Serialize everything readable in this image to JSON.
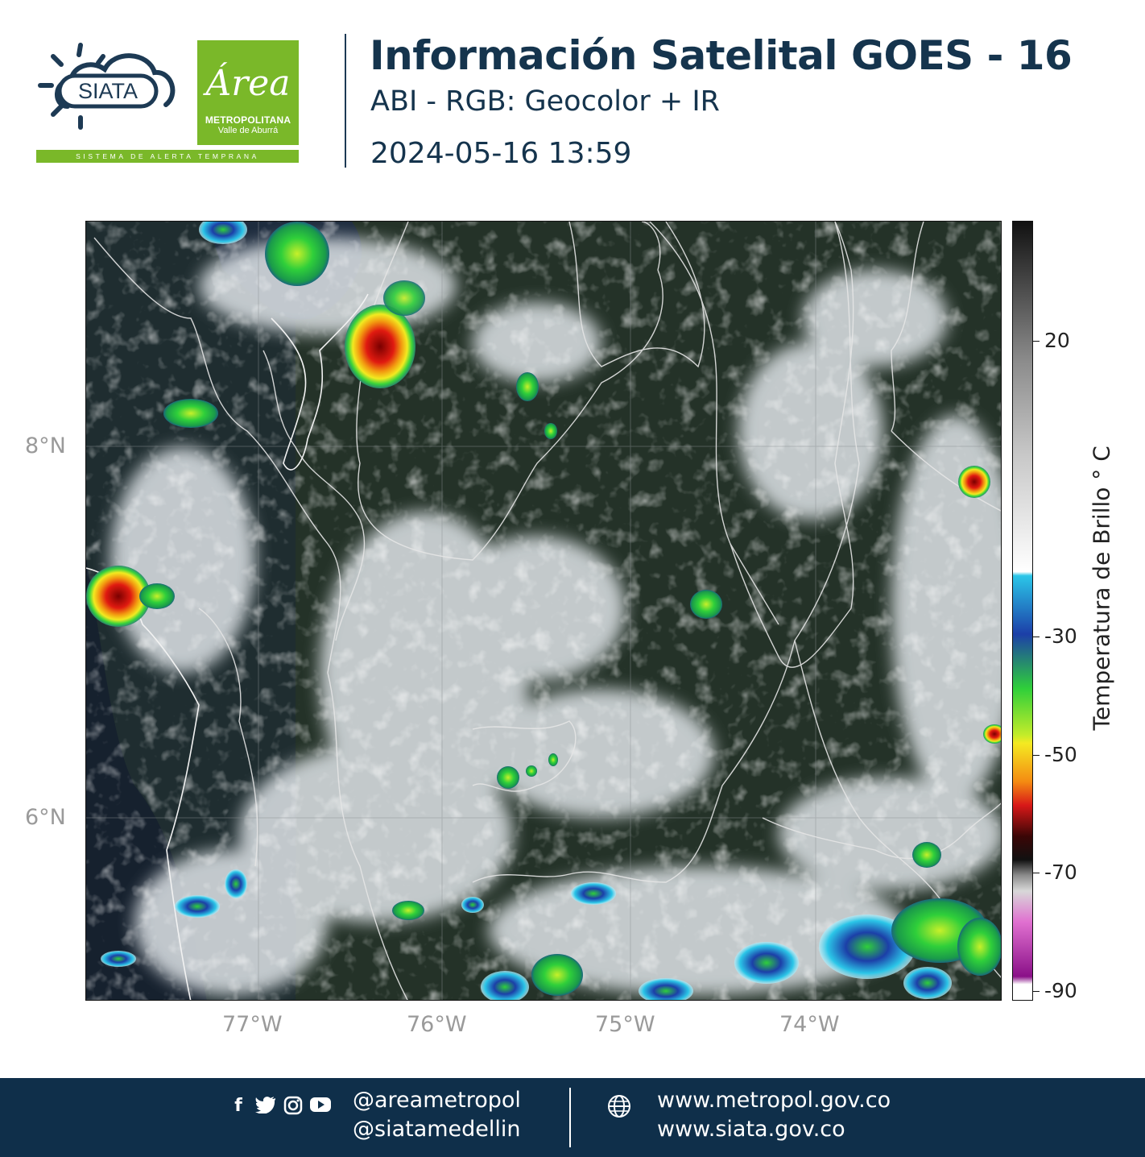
{
  "header": {
    "siata_logo_text": "SIATA",
    "area_logo_word": "Área",
    "area_logo_line1": "METROPOLITANA",
    "area_logo_line2": "Valle de Aburrá",
    "tagline": "SISTEMA DE ALERTA TEMPRANA",
    "title": "Información Satelital GOES - 16",
    "subtitle": "ABI - RGB: Geocolor + IR",
    "timestamp": "2024-05-16 13:59"
  },
  "map": {
    "lat_labels": [
      "8°N",
      "6°N"
    ],
    "lon_labels": [
      "77°W",
      "76°W",
      "75°W",
      "74°W"
    ],
    "colorbar": {
      "label": "Temperatura de Brillo ° C",
      "ticks": [
        "20",
        "-30",
        "-50",
        "-70",
        "-90"
      ],
      "colors": {
        "warm_black": "#111111",
        "gray": "#8c8c8c",
        "white": "#ffffff",
        "cyan": "#2bc6e8",
        "blue": "#1c3fa8",
        "green": "#2fcf3a",
        "yellow": "#f4ea22",
        "orange": "#f48a12",
        "red": "#d81818",
        "dark_red": "#3a0606",
        "pink": "#e070d0",
        "purple": "#8a1088"
      }
    },
    "icons": [
      "map-coastline",
      "map-admin-borders",
      "convective-cells"
    ]
  },
  "footer": {
    "social_icons": [
      "facebook-icon",
      "twitter-icon",
      "instagram-icon",
      "youtube-icon"
    ],
    "handles": [
      "@areametropol",
      "@siatamedellin"
    ],
    "sites": [
      "www.metropol.gov.co",
      "www.siata.gov.co"
    ]
  }
}
